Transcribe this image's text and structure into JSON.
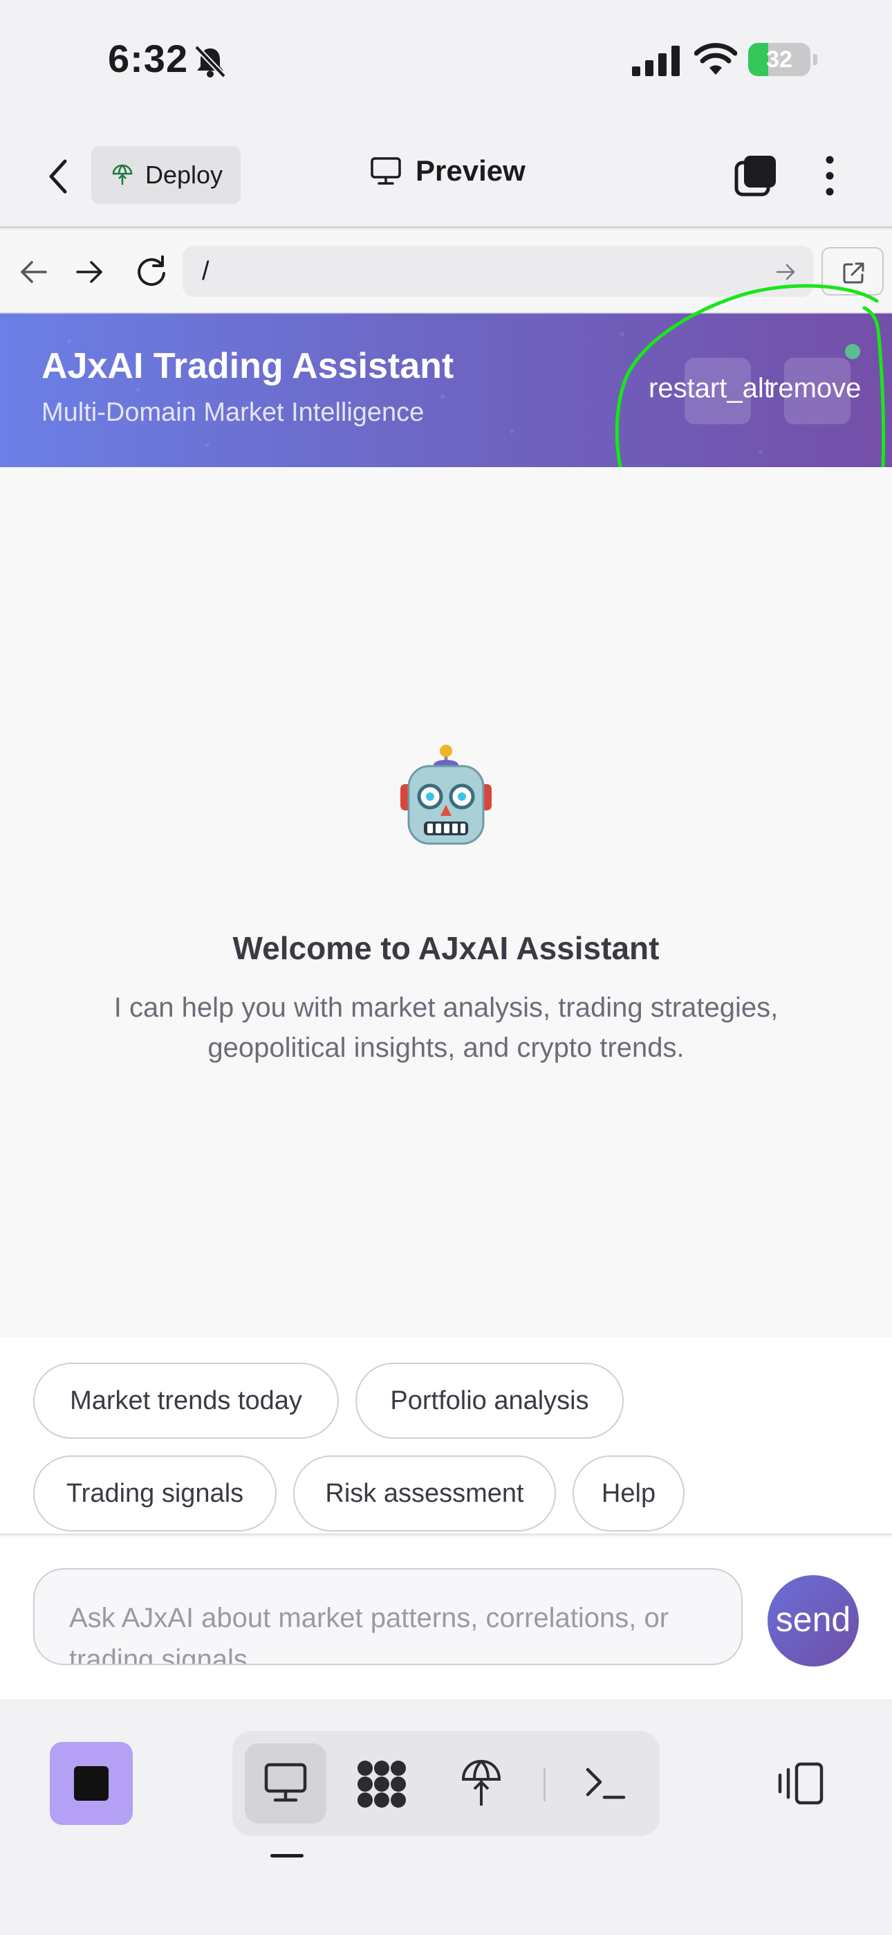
{
  "status_bar": {
    "time": "6:32",
    "battery": "32",
    "battery_level": 0.32
  },
  "app_bar": {
    "deploy_label": "Deploy",
    "preview_label": "Preview"
  },
  "browser": {
    "url": "/"
  },
  "header": {
    "title": "AJxAI Trading Assistant",
    "subtitle": "Multi-Domain Market Intelligence",
    "button_1_label": "restart_alt",
    "button_2_label": "remove"
  },
  "welcome": {
    "title": "Welcome to AJxAI Assistant",
    "text": "I can help you with market analysis, trading strategies, geopolitical insights, and crypto trends."
  },
  "suggestions": [
    "Market trends today",
    "Portfolio analysis",
    "Trading signals",
    "Risk assessment",
    "Help"
  ],
  "input": {
    "placeholder": "Ask AJxAI about market patterns, correlations, or trading signals...",
    "send_label": "send"
  },
  "colors": {
    "header_start": "#6b7fe6",
    "header_end": "#744fa8",
    "annotation": "#19e619",
    "stop_button": "#b4a0f5"
  }
}
